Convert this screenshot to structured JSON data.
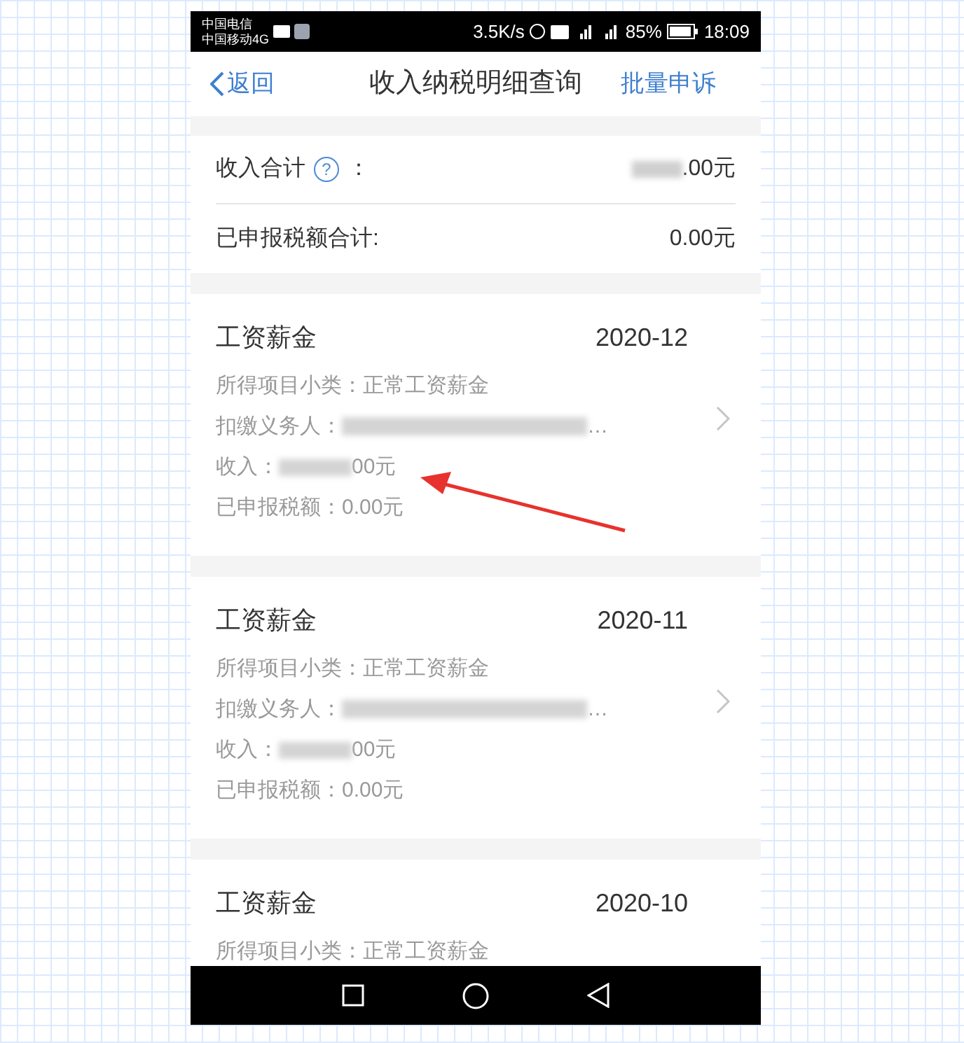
{
  "status_bar": {
    "carriers": [
      "中国电信",
      "中国移动4G"
    ],
    "speed": "3.5K/s",
    "battery": "85%",
    "time": "18:09"
  },
  "nav": {
    "back": "返回",
    "title": "收入纳税明细查询",
    "action": "批量申诉"
  },
  "summary": [
    {
      "kind": "help",
      "label": "收入合计",
      "help_glyph": "?",
      "colon": "：",
      "value": ".00元",
      "redacted": true
    },
    {
      "kind": "plain",
      "label": "已申报税额合计:",
      "value": "0.00元",
      "redacted": false
    }
  ],
  "records": [
    {
      "category": "工资薪金",
      "date": "2020-12",
      "subtype": "所得项目小类：正常工资薪金",
      "payer_label": "扣缴义务人：",
      "payer_end": "…",
      "income_label": "收入：",
      "income": "00元",
      "tax": "已申报税额：0.00元"
    },
    {
      "category": "工资薪金",
      "date": "2020-11",
      "subtype": "所得项目小类：正常工资薪金",
      "payer_label": "扣缴义务人：",
      "payer_end": "…",
      "income_label": "收入：",
      "income": "00元",
      "tax": "已申报税额：0.00元"
    },
    {
      "category": "工资薪金",
      "date": "2020-10",
      "subtype": "所得项目小类：正常工资薪金"
    }
  ]
}
